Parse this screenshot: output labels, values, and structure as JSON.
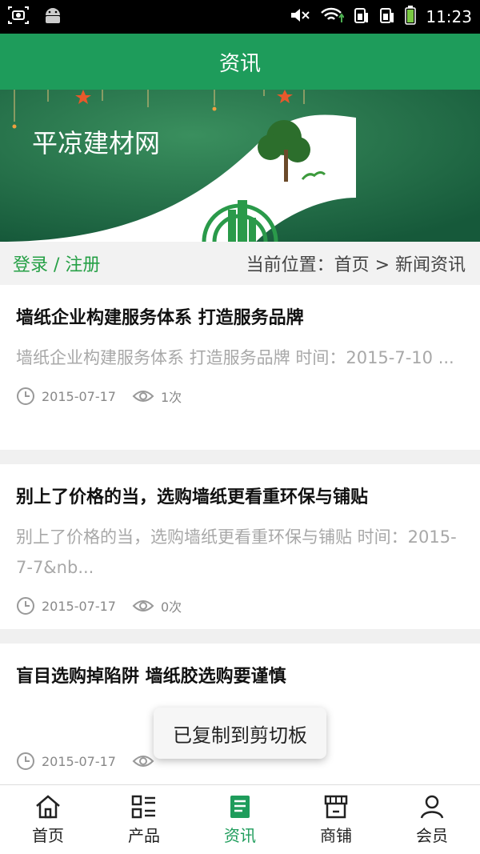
{
  "status_bar": {
    "time": "11:23"
  },
  "app_bar": {
    "title": "资讯"
  },
  "banner": {
    "text": "平凉建材网"
  },
  "crumb": {
    "login_text": "登录 / 注册",
    "location_text": "当前位置：首页 > 新闻资讯"
  },
  "news": [
    {
      "title": "墙纸企业构建服务体系 打造服务品牌",
      "summary": "墙纸企业构建服务体系 打造服务品牌 时间：2015-7-10 ...",
      "date": "2015-07-17",
      "views": "1次"
    },
    {
      "title": "别上了价格的当，选购墙纸更看重环保与铺贴",
      "summary": "别上了价格的当，选购墙纸更看重环保与铺贴 时间：2015-7-7&nb...",
      "date": "2015-07-17",
      "views": "0次"
    },
    {
      "title": "盲目选购掉陷阱 墙纸胶选购要谨慎",
      "summary": "",
      "date": "2015-07-17",
      "views": ""
    }
  ],
  "toast": {
    "text": "已复制到剪切板"
  },
  "tabs": [
    {
      "label": "首页",
      "icon": "home-icon"
    },
    {
      "label": "产品",
      "icon": "product-list-icon"
    },
    {
      "label": "资讯",
      "icon": "news-icon"
    },
    {
      "label": "商铺",
      "icon": "shop-icon"
    },
    {
      "label": "会员",
      "icon": "member-icon"
    }
  ],
  "colors": {
    "brand_green": "#1e9c5b",
    "login_green": "#26a046"
  }
}
